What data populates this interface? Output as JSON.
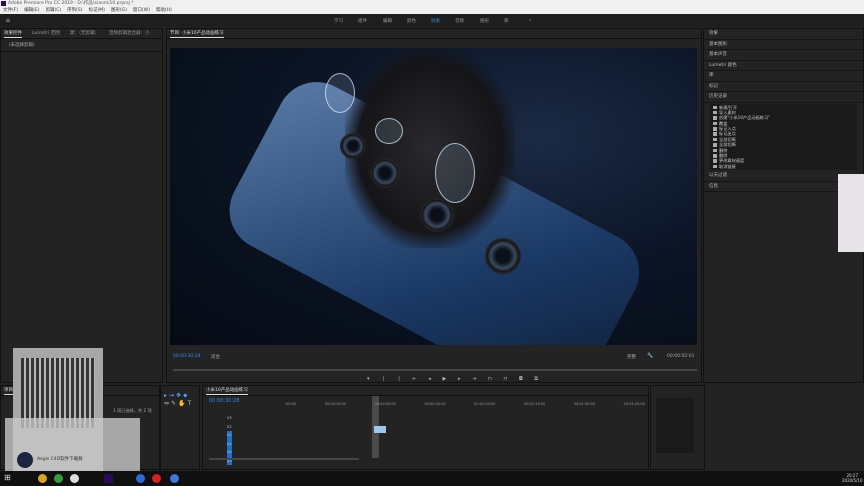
{
  "window": {
    "title": "Adobe Premiere Pro CC 2019 - D:\\作品\\xiaomi10.prproj *"
  },
  "menu": [
    "文件(F)",
    "编辑(E)",
    "剪辑(C)",
    "序列(S)",
    "标记(M)",
    "图形(G)",
    "窗口(W)",
    "帮助(H)"
  ],
  "workspaces": [
    "学习",
    "组件",
    "编辑",
    "颜色",
    "效果",
    "音频",
    "图形",
    "库",
    "»"
  ],
  "left": {
    "tabs": [
      "效果控件",
      "Lumetri 范围",
      "源：（无剪辑）",
      "音频剪辑混合器：小"
    ],
    "empty": "（未选择剪辑）"
  },
  "program": {
    "title": "节目: 小米10产品动画练习",
    "timecode": "00:00:30:28",
    "fit": "适合",
    "quality": "完整",
    "duration": "00:00:02:01"
  },
  "right": {
    "panels": [
      "效果",
      "基本图形",
      "基本声音",
      "Lumetri 颜色",
      "库",
      "标记"
    ],
    "history_title": "历史记录",
    "history": [
      "新建/打开",
      "导入素材",
      "创建\"小米10产品动画练习\"",
      "覆盖",
      "标记入点",
      "标记出点",
      "全部切断",
      "全部切断",
      "删除",
      "删除",
      "更改素材速度",
      "取消链接"
    ],
    "after": [
      "以天过滤",
      "信息"
    ]
  },
  "project": {
    "tab": "项目",
    "selection": "1 项已选择，共 2 项"
  },
  "timeline": {
    "tab": "小米10产品动画练习",
    "timecode": "00:00:30:28",
    "ruler": [
      ":00:00",
      "00:00:15:00",
      "00:00:30:00",
      "00:00:45:00",
      "00:01:00:00",
      "00:01:15:00",
      "00:01:30:00",
      "00:01:45:00"
    ],
    "tracks": [
      "V3",
      "V2",
      "V1",
      "A1",
      "A2",
      "A3"
    ]
  },
  "overlay": {
    "popup_text": "Aegis C4D软件下载群"
  },
  "clock": {
    "time": "20:27",
    "date": "2020/5/10"
  }
}
